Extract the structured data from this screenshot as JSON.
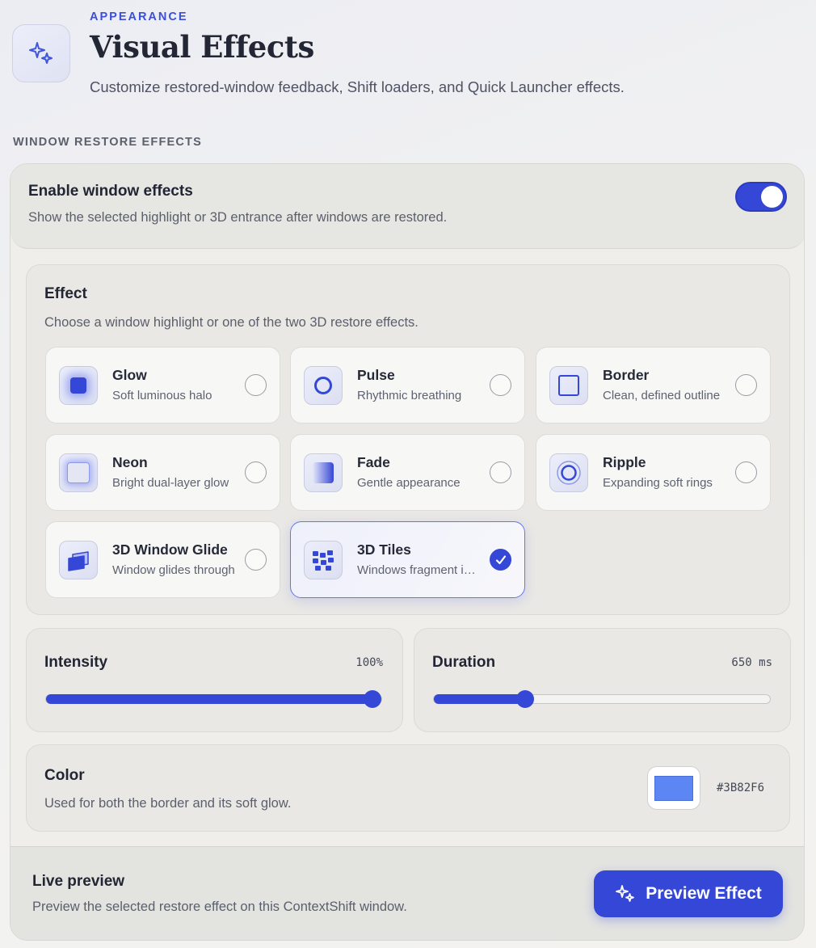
{
  "header": {
    "eyebrow": "APPEARANCE",
    "title": "Visual Effects",
    "subtitle": "Customize restored-window feedback, Shift loaders, and Quick Launcher effects.",
    "icon": "sparkles-icon"
  },
  "section_label": "WINDOW RESTORE EFFECTS",
  "enable": {
    "title": "Enable window effects",
    "description": "Show the selected highlight or 3D entrance after windows are restored.",
    "enabled": true
  },
  "effect": {
    "title": "Effect",
    "description": "Choose a window highlight or one of the two 3D restore effects.",
    "options": [
      {
        "label": "Glow",
        "desc": "Soft luminous halo",
        "icon": "glow-icon",
        "selected": false
      },
      {
        "label": "Pulse",
        "desc": "Rhythmic breathing",
        "icon": "pulse-icon",
        "selected": false
      },
      {
        "label": "Border",
        "desc": "Clean, defined outline",
        "icon": "border-icon",
        "selected": false
      },
      {
        "label": "Neon",
        "desc": "Bright dual-layer glow",
        "icon": "neon-icon",
        "selected": false
      },
      {
        "label": "Fade",
        "desc": "Gentle appearance",
        "icon": "fade-icon",
        "selected": false
      },
      {
        "label": "Ripple",
        "desc": "Expanding soft rings",
        "icon": "ripple-icon",
        "selected": false
      },
      {
        "label": "3D Window Glide",
        "desc": "Window glides through",
        "icon": "window-glide-icon",
        "selected": false
      },
      {
        "label": "3D Tiles",
        "desc": "Windows fragment into tiles",
        "icon": "tiles-icon",
        "selected": true
      }
    ]
  },
  "intensity": {
    "label": "Intensity",
    "value_text": "100%",
    "value": 1.0
  },
  "duration": {
    "label": "Duration",
    "value_text": "650 ms",
    "value": 0.26
  },
  "color": {
    "label": "Color",
    "description": "Used for both the border and its soft glow.",
    "hex": "#3B82F6"
  },
  "preview": {
    "title": "Live preview",
    "description": "Preview the selected restore effect on this ContextShift window.",
    "button_label": "Preview Effect"
  },
  "colors": {
    "accent": "#3547D6"
  }
}
